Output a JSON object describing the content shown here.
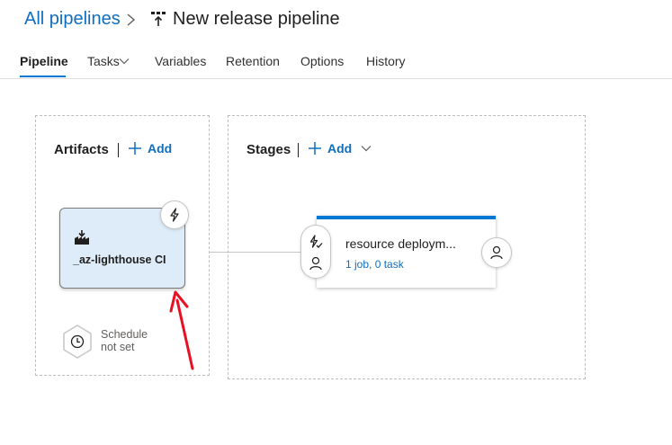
{
  "header": {
    "breadcrumb_link": "All pipelines",
    "title": "New release pipeline"
  },
  "tabs": [
    {
      "label": "Pipeline",
      "active": true
    },
    {
      "label": "Tasks",
      "has_dropdown": true
    },
    {
      "label": "Variables"
    },
    {
      "label": "Retention"
    },
    {
      "label": "Options"
    },
    {
      "label": "History"
    }
  ],
  "artifacts": {
    "title": "Artifacts",
    "add_label": "Add",
    "item": {
      "name": "_az-lighthouse CI",
      "icon": "build-artifact-icon",
      "trigger_icon": "lightning-icon"
    },
    "schedule": {
      "line1": "Schedule",
      "line2": "not set",
      "icon": "clock-icon"
    }
  },
  "stages": {
    "title": "Stages",
    "add_label": "Add",
    "items": [
      {
        "name": "resource deploym...",
        "summary": "1 job, 0 task"
      }
    ]
  },
  "colors": {
    "accent": "#0078d4",
    "link": "#106ebe",
    "artifact_bg": "#deecf9",
    "annotation_arrow": "#e81123"
  }
}
